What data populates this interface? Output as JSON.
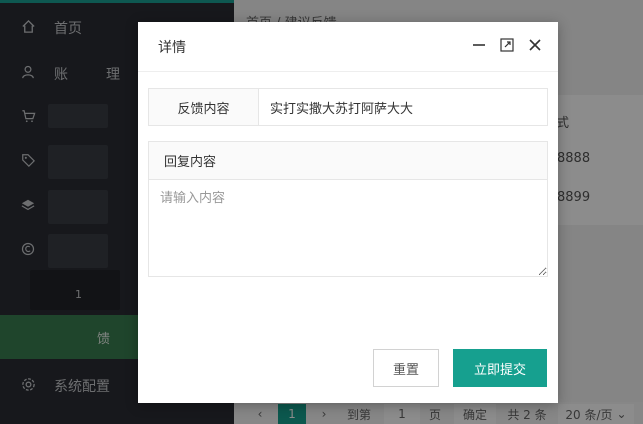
{
  "sidebar": {
    "items": [
      {
        "label": "首页",
        "icon": "home-icon"
      },
      {
        "label": "账",
        "icon": "user-icon"
      },
      {
        "label": "",
        "icon": "cart-icon"
      },
      {
        "label": "",
        "icon": "tag-icon"
      },
      {
        "label": "",
        "icon": "layers-icon"
      },
      {
        "label": "",
        "icon": "coin-icon"
      },
      {
        "label": "",
        "icon": ""
      },
      {
        "label": "",
        "icon": ""
      },
      {
        "label": "系统配置",
        "icon": "gear-icon"
      }
    ],
    "partial_text": [
      "理",
      "1",
      "馈"
    ],
    "accent": "#1aa094",
    "active_bg": "#3a7f50"
  },
  "breadcrumb": "首页 / 建议反馈",
  "table": {
    "header_fragment": "式",
    "cells": [
      "8888",
      "8899"
    ]
  },
  "pager": {
    "current_page": "1",
    "goto_label": "到第",
    "page_input": "1",
    "page_unit": "页",
    "confirm": "确定",
    "total": "共 2 条",
    "per_page": "20 条/页"
  },
  "modal": {
    "title": "详情",
    "feedback_label": "反馈内容",
    "feedback_value": "实打实撒大苏打阿萨大大",
    "reply_label": "回复内容",
    "reply_placeholder": "请输入内容",
    "reset": "重置",
    "submit": "立即提交",
    "submit_color": "#16a08f"
  }
}
